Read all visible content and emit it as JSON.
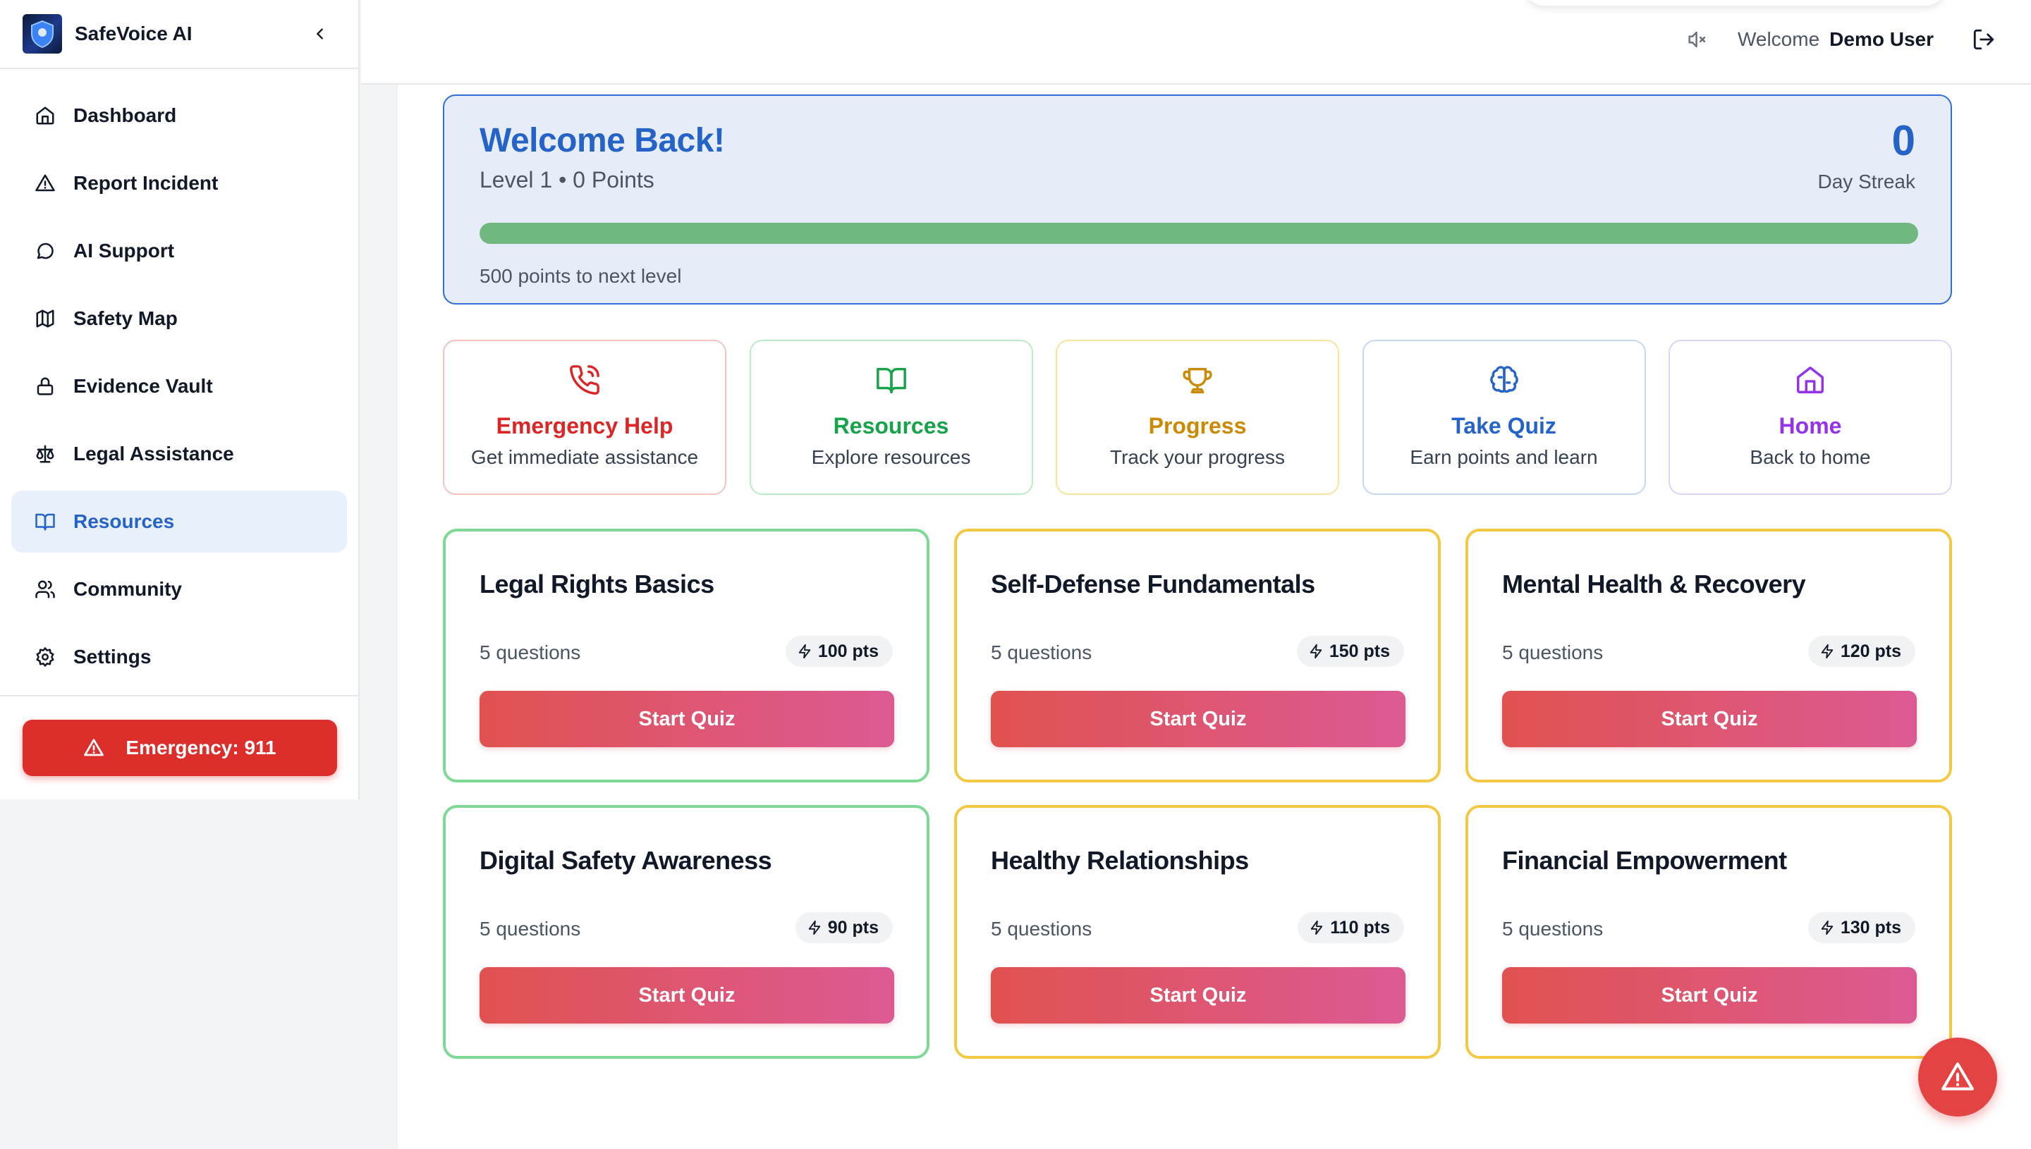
{
  "app": {
    "name": "SafeVoice AI"
  },
  "sidebar": {
    "items": [
      {
        "label": "Dashboard",
        "icon": "home-icon"
      },
      {
        "label": "Report Incident",
        "icon": "alert-triangle-icon"
      },
      {
        "label": "AI Support",
        "icon": "chat-bubble-icon"
      },
      {
        "label": "Safety Map",
        "icon": "map-icon"
      },
      {
        "label": "Evidence Vault",
        "icon": "lock-icon"
      },
      {
        "label": "Legal Assistance",
        "icon": "scale-icon"
      },
      {
        "label": "Resources",
        "icon": "book-icon",
        "active": true
      },
      {
        "label": "Community",
        "icon": "users-icon"
      },
      {
        "label": "Settings",
        "icon": "gear-icon"
      }
    ],
    "emergency_label": "Emergency: 911"
  },
  "topbar": {
    "welcome_label": "Welcome",
    "user_name": "Demo User"
  },
  "welcome_card": {
    "title": "Welcome Back!",
    "subtitle": "Level 1 • 0 Points",
    "streak_value": "0",
    "streak_label": "Day Streak",
    "progress_fraction": 1.0,
    "next_level_text": "500 points to next level"
  },
  "quick_actions": [
    {
      "title": "Emergency Help",
      "desc": "Get immediate assistance",
      "icon": "phone-icon",
      "color": "#dc2626",
      "border": "#f5c2c2"
    },
    {
      "title": "Resources",
      "desc": "Explore resources",
      "icon": "book-icon",
      "color": "#16a34a",
      "border": "#bdebc8"
    },
    {
      "title": "Progress",
      "desc": "Track your progress",
      "icon": "trophy-icon",
      "color": "#ca8a04",
      "border": "#f7e59a"
    },
    {
      "title": "Take Quiz",
      "desc": "Earn points and learn",
      "icon": "brain-icon",
      "color": "#2563c9",
      "border": "#c7d7f5"
    },
    {
      "title": "Home",
      "desc": "Back to home",
      "icon": "home-icon",
      "color": "#9333ea",
      "border": "#e0d4f5"
    }
  ],
  "quizzes": [
    {
      "title": "Legal Rights Basics",
      "count": "5 questions",
      "points": "100 pts",
      "button": "Start Quiz",
      "accent": "green"
    },
    {
      "title": "Self-Defense Fundamentals",
      "count": "5 questions",
      "points": "150 pts",
      "button": "Start Quiz",
      "accent": "yellow"
    },
    {
      "title": "Mental Health & Recovery",
      "count": "5 questions",
      "points": "120 pts",
      "button": "Start Quiz",
      "accent": "yellow"
    },
    {
      "title": "Digital Safety Awareness",
      "count": "5 questions",
      "points": "90 pts",
      "button": "Start Quiz",
      "accent": "green"
    },
    {
      "title": "Healthy Relationships",
      "count": "5 questions",
      "points": "110 pts",
      "button": "Start Quiz",
      "accent": "yellow"
    },
    {
      "title": "Financial Empowerment",
      "count": "5 questions",
      "points": "130 pts",
      "button": "Start Quiz",
      "accent": "yellow"
    }
  ],
  "colors": {
    "primary": "#2563c9",
    "emergency": "#dc2e2a",
    "progress": "#70b87f"
  }
}
